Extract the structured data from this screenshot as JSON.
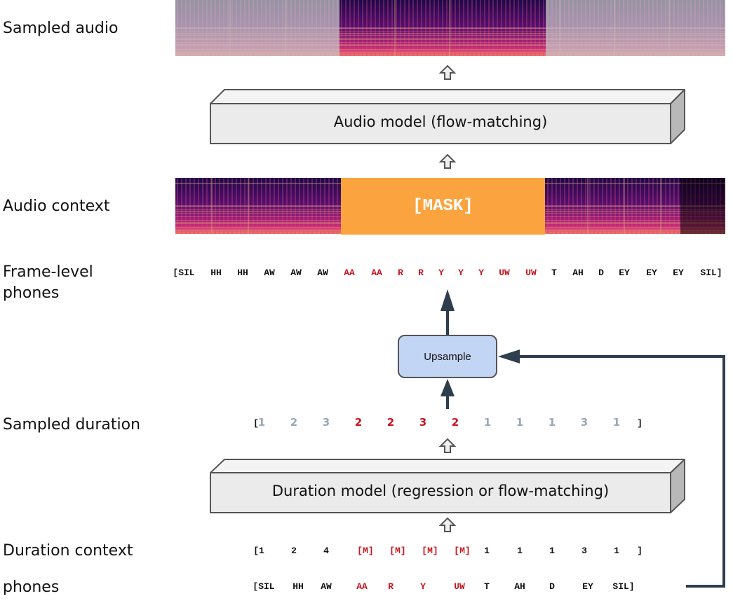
{
  "labels": {
    "sampled_audio": "Sampled audio",
    "audio_context": "Audio context",
    "frame_level_phones_1": "Frame-level",
    "frame_level_phones_2": "phones",
    "sampled_duration": "Sampled duration",
    "duration_context": "Duration context",
    "phones": "phones"
  },
  "audio_model": {
    "label": "Audio model (flow-matching)"
  },
  "duration_model": {
    "label": "Duration model (regression or flow-matching)"
  },
  "mask": {
    "label": "[MASK]"
  },
  "upsample": {
    "label": "Upsample"
  },
  "colors": {
    "masked": "#c8141e",
    "context": "#111111",
    "sampled_context": "#9aa8b6",
    "mask_fill": "#fba43f",
    "upsample_fill": "#c3d5f4",
    "arrow": "#2e3e4c",
    "box_face": "#ebebeb",
    "box_side": "#b8b8b8"
  },
  "frame_level_phones": [
    {
      "t": "[SIL",
      "m": false
    },
    {
      "t": "HH",
      "m": false
    },
    {
      "t": "HH",
      "m": false
    },
    {
      "t": "AW",
      "m": false
    },
    {
      "t": "AW",
      "m": false
    },
    {
      "t": "AW",
      "m": false
    },
    {
      "t": "AA",
      "m": true
    },
    {
      "t": "AA",
      "m": true
    },
    {
      "t": "R",
      "m": true
    },
    {
      "t": "R",
      "m": true
    },
    {
      "t": "Y",
      "m": true
    },
    {
      "t": "Y",
      "m": true
    },
    {
      "t": "Y",
      "m": true
    },
    {
      "t": "UW",
      "m": true
    },
    {
      "t": "UW",
      "m": true
    },
    {
      "t": "T",
      "m": false
    },
    {
      "t": "AH",
      "m": false
    },
    {
      "t": "D",
      "m": false
    },
    {
      "t": "EY",
      "m": false
    },
    {
      "t": "EY",
      "m": false
    },
    {
      "t": "EY",
      "m": false
    },
    {
      "t": "SIL]",
      "m": false
    }
  ],
  "sampled_duration": {
    "open": "[",
    "close": "]",
    "values": [
      {
        "t": "1",
        "m": false
      },
      {
        "t": "2",
        "m": false
      },
      {
        "t": "3",
        "m": false
      },
      {
        "t": "2",
        "m": true
      },
      {
        "t": "2",
        "m": true
      },
      {
        "t": "3",
        "m": true
      },
      {
        "t": "2",
        "m": true
      },
      {
        "t": "1",
        "m": false
      },
      {
        "t": "1",
        "m": false
      },
      {
        "t": "1",
        "m": false
      },
      {
        "t": "3",
        "m": false
      },
      {
        "t": "1",
        "m": false
      }
    ]
  },
  "duration_context": [
    {
      "t": "[1",
      "m": false
    },
    {
      "t": "2",
      "m": false
    },
    {
      "t": "4",
      "m": false
    },
    {
      "t": "[M]",
      "m": true
    },
    {
      "t": "[M]",
      "m": true
    },
    {
      "t": "[M]",
      "m": true
    },
    {
      "t": "[M]",
      "m": true
    },
    {
      "t": "1",
      "m": false
    },
    {
      "t": "1",
      "m": false
    },
    {
      "t": "1",
      "m": false
    },
    {
      "t": "3",
      "m": false
    },
    {
      "t": "1",
      "m": false
    },
    {
      "t": "]",
      "m": false
    }
  ],
  "phones": [
    {
      "t": "[SIL",
      "m": false
    },
    {
      "t": "HH",
      "m": false
    },
    {
      "t": "AW",
      "m": false
    },
    {
      "t": "AA",
      "m": true
    },
    {
      "t": "R",
      "m": true
    },
    {
      "t": "Y",
      "m": true
    },
    {
      "t": "UW",
      "m": true
    },
    {
      "t": "T",
      "m": false
    },
    {
      "t": "AH",
      "m": false
    },
    {
      "t": "D",
      "m": false
    },
    {
      "t": "EY",
      "m": false
    },
    {
      "t": "SIL]",
      "m": false
    }
  ]
}
